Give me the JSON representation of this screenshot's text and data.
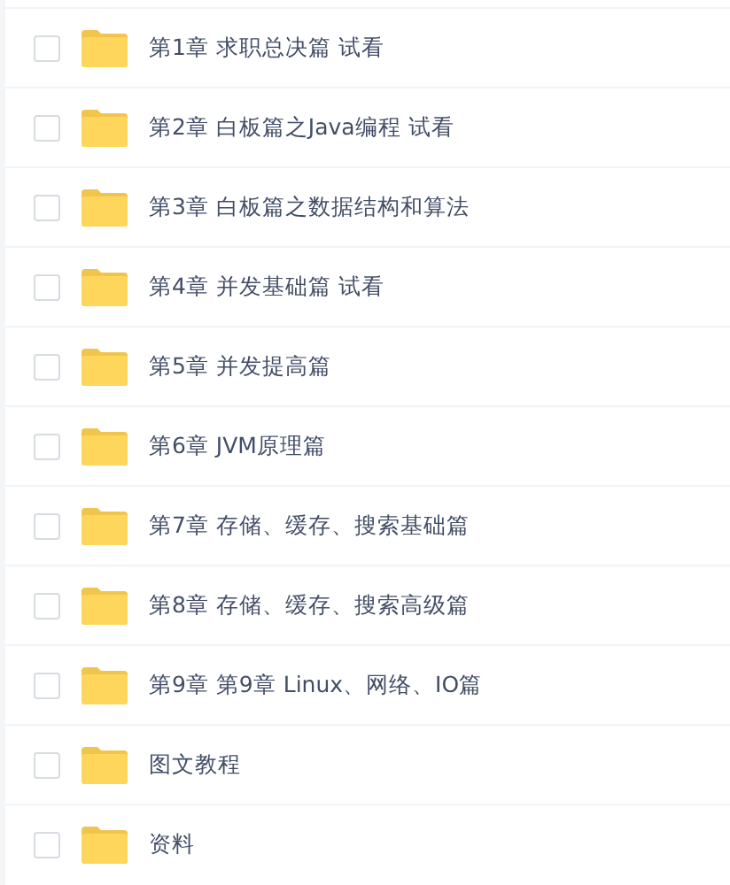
{
  "files": [
    {
      "name": "第1章 求职总决篇 试看",
      "checked": false
    },
    {
      "name": "第2章 白板篇之Java编程 试看",
      "checked": false
    },
    {
      "name": "第3章 白板篇之数据结构和算法",
      "checked": false
    },
    {
      "name": "第4章 并发基础篇 试看",
      "checked": false
    },
    {
      "name": "第5章 并发提高篇",
      "checked": false
    },
    {
      "name": "第6章 JVM原理篇",
      "checked": false
    },
    {
      "name": "第7章 存储、缓存、搜索基础篇",
      "checked": false
    },
    {
      "name": "第8章 存储、缓存、搜索高级篇",
      "checked": false
    },
    {
      "name": "第9章 第9章 Linux、网络、IO篇",
      "checked": false
    },
    {
      "name": "图文教程",
      "checked": false
    },
    {
      "name": "资料",
      "checked": false
    }
  ]
}
